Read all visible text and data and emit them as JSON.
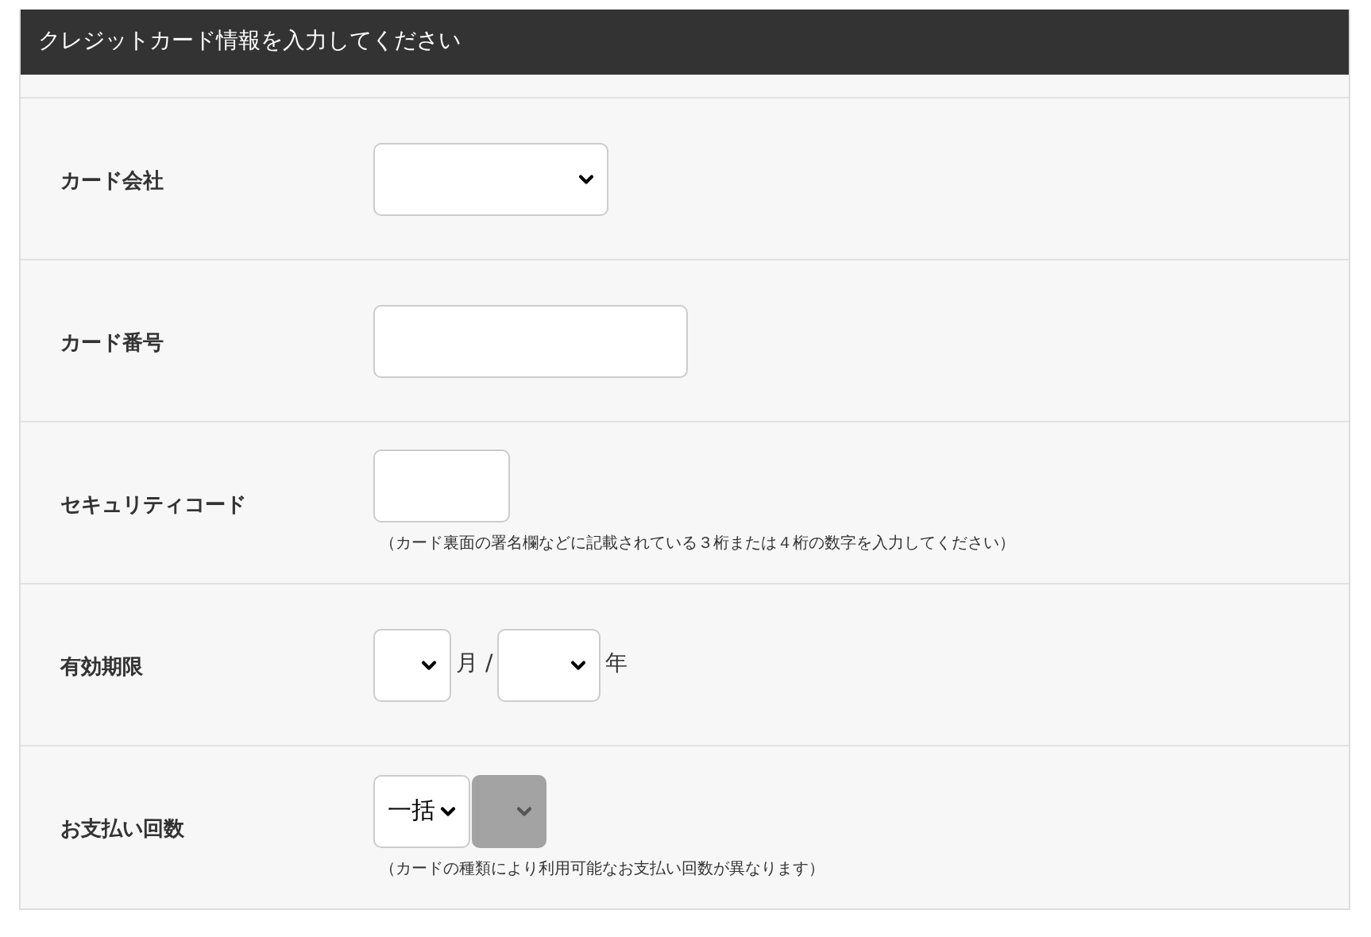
{
  "header": {
    "title": "クレジットカード情報を入力してください"
  },
  "rows": [
    {
      "label": "カード会社",
      "controls": [
        {
          "kind": "select",
          "disabled": false
        }
      ]
    },
    {
      "label": "カード番号",
      "controls": [
        {
          "kind": "input"
        }
      ]
    },
    {
      "label": "セキュリティコード",
      "controls": [
        {
          "kind": "input"
        }
      ],
      "note": "（カード裏面の署名欄などに記載されている３桁または４桁の数字を入力してください）"
    },
    {
      "label": "有効期限",
      "controls": [
        {
          "kind": "select",
          "disabled": false
        },
        {
          "kind": "text",
          "text": "月 /"
        },
        {
          "kind": "select",
          "disabled": false
        },
        {
          "kind": "text",
          "text": "年"
        }
      ]
    },
    {
      "label": "お支払い回数",
      "controls": [
        {
          "kind": "select",
          "value": "一括",
          "disabled": false
        },
        {
          "kind": "select",
          "disabled": true
        }
      ],
      "note": "（カードの種類により利用可能なお支払い回数が異なります）"
    }
  ]
}
